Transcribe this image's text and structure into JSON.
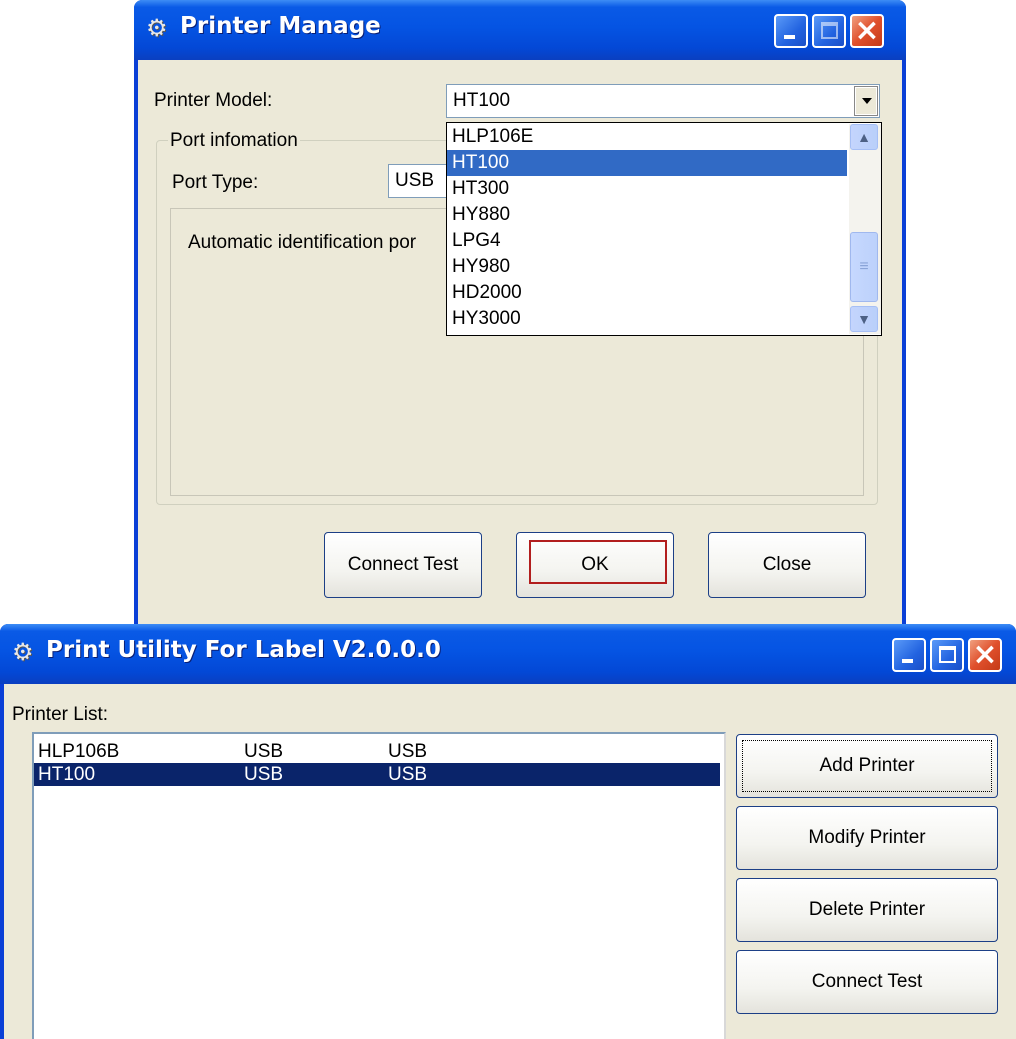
{
  "printer_manage": {
    "title": "Printer Manage",
    "printer_model_label": "Printer Model:",
    "printer_model_value": "HT100",
    "port_group_label": "Port infomation",
    "port_type_label": "Port Type:",
    "port_type_value": "USB",
    "auto_identification_text": "Automatic identification por",
    "model_options": [
      "HLP106E",
      "HT100",
      "HT300",
      "HY880",
      "LPG4",
      "HY980",
      "HD2000",
      "HY3000"
    ],
    "selected_model_index": 1,
    "buttons": {
      "connect_test": "Connect Test",
      "ok": "OK",
      "close": "Close"
    }
  },
  "print_utility": {
    "title": "Print Utility For Label V2.0.0.0",
    "printer_list_label": "Printer List:",
    "printers": [
      {
        "name": "HLP106B",
        "port": "USB",
        "type": "USB"
      },
      {
        "name": "HT100",
        "port": "USB",
        "type": "USB"
      }
    ],
    "selected_printer_index": 1,
    "buttons": {
      "add": "Add Printer",
      "modify": "Modify Printer",
      "delete": "Delete Printer",
      "connect_test": "Connect Test"
    }
  },
  "colors": {
    "xp_title_blue": "#0554e3",
    "dialog_face": "#ece9d8",
    "list_selection": "#0a246a",
    "dropdown_selection": "#316ac5",
    "ok_focus": "#b21e1e"
  }
}
